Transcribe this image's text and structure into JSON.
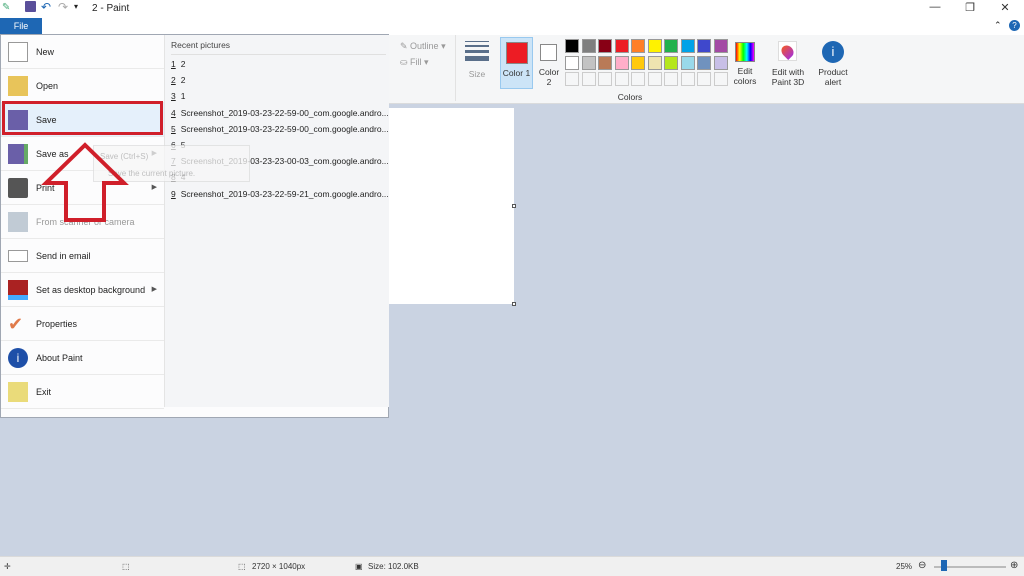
{
  "title": "2 - Paint",
  "file_tab": "File",
  "menu": {
    "items": [
      {
        "label": "New",
        "icon": "new-file-icon",
        "arrow": false
      },
      {
        "label": "Open",
        "icon": "open-folder-icon",
        "arrow": false
      },
      {
        "label": "Save",
        "icon": "save-icon",
        "arrow": false
      },
      {
        "label": "Save as",
        "icon": "save-as-icon",
        "arrow": true
      },
      {
        "label": "Print",
        "icon": "printer-icon",
        "arrow": true
      },
      {
        "label": "From scanner or camera",
        "icon": "scanner-icon",
        "arrow": false,
        "disabled": true
      },
      {
        "label": "Send in email",
        "icon": "email-icon",
        "arrow": false
      },
      {
        "label": "Set as desktop background",
        "icon": "desktop-icon",
        "arrow": true
      },
      {
        "label": "Properties",
        "icon": "checkmark-icon",
        "arrow": false
      },
      {
        "label": "About Paint",
        "icon": "info-icon",
        "arrow": false
      },
      {
        "label": "Exit",
        "icon": "exit-icon",
        "arrow": false
      }
    ],
    "recent_header": "Recent pictures",
    "recent": [
      {
        "n": "1",
        "name": "2"
      },
      {
        "n": "2",
        "name": "2"
      },
      {
        "n": "3",
        "name": "1"
      },
      {
        "n": "4",
        "name": "Screenshot_2019-03-23-22-59-00_com.google.andro..."
      },
      {
        "n": "5",
        "name": "Screenshot_2019-03-23-22-59-00_com.google.andro..."
      },
      {
        "n": "6",
        "name": "5"
      },
      {
        "n": "7",
        "name": "Screenshot_2019-03-23-23-00-03_com.google.andro..."
      },
      {
        "n": "8",
        "name": "4"
      },
      {
        "n": "9",
        "name": "Screenshot_2019-03-23-22-59-21_com.google.andro..."
      }
    ],
    "tooltip_title": "Save (Ctrl+S)",
    "tooltip_desc": "Save the current picture."
  },
  "ribbon": {
    "outline": "Outline",
    "fill": "Fill",
    "size": "Size",
    "color1": "Color 1",
    "color2": "Color 2",
    "colors_group": "Colors",
    "edit_colors": "Edit colors",
    "paint3d": "Edit with Paint 3D",
    "product_alert": "Product alert",
    "color1_value": "#ed1c24",
    "color2_value": "#ffffff",
    "palette_row1": [
      "#000000",
      "#7f7f7f",
      "#880015",
      "#ed1c24",
      "#ff7f27",
      "#fff200",
      "#22b14c",
      "#00a2e8",
      "#3f48cc",
      "#a349a4"
    ],
    "palette_row2": [
      "#ffffff",
      "#c3c3c3",
      "#b97a57",
      "#ffaec9",
      "#ffc90e",
      "#efe4b0",
      "#b5e61d",
      "#99d9ea",
      "#7092be",
      "#c8bfe7"
    ]
  },
  "status": {
    "dimensions": "2720 × 1040px",
    "size": "Size: 102.0KB",
    "zoom": "25%",
    "zoom_fraction": 0.1
  },
  "colors": {
    "accent": "#1e67b4",
    "highlight": "#d01f2a"
  }
}
